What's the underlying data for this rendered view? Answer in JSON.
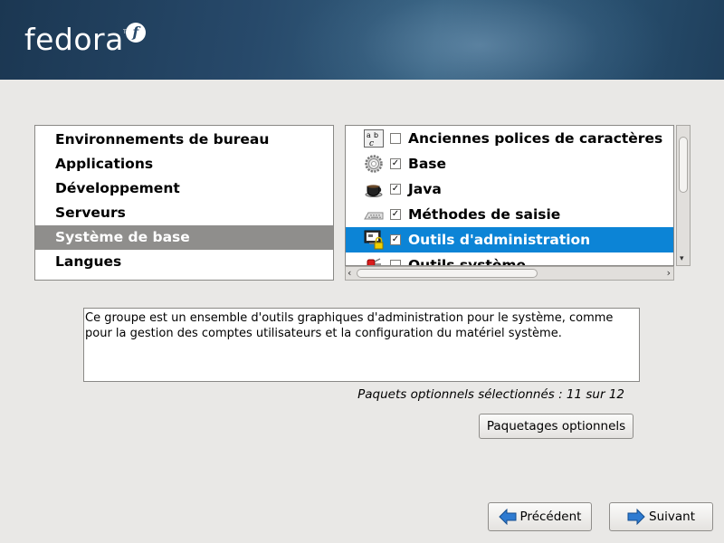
{
  "header": {
    "logo_text": "fedora",
    "logo_mark": "f",
    "logo_tm": "TM"
  },
  "groups": {
    "items": [
      {
        "label": "Environnements de bureau"
      },
      {
        "label": "Applications"
      },
      {
        "label": "Développement"
      },
      {
        "label": "Serveurs"
      },
      {
        "label": "Système de base",
        "selected": true
      },
      {
        "label": "Langues"
      }
    ]
  },
  "packages": {
    "items": [
      {
        "label": "Anciennes polices de caractères",
        "icon": "fonts-icon",
        "checked": false
      },
      {
        "label": "Base",
        "icon": "gear-icon",
        "checked": true
      },
      {
        "label": "Java",
        "icon": "coffee-cup-icon",
        "checked": true
      },
      {
        "label": "Méthodes de saisie",
        "icon": "keyboard-icon",
        "checked": true
      },
      {
        "label": "Outils d'administration",
        "icon": "admin-monitor-lock-icon",
        "checked": true,
        "selected": true
      },
      {
        "label": "Outils système",
        "icon": "system-tools-icon",
        "checked": false
      }
    ]
  },
  "description": {
    "text": "Ce groupe est un ensemble d'outils graphiques d'administration pour le système, comme pour la gestion des comptes utilisateurs et la configuration du matériel système."
  },
  "optional_count": "Paquets optionnels sélectionnés : 11 sur 12",
  "buttons": {
    "optional": "Paquetages optionnels",
    "previous": "Précédent",
    "next": "Suivant"
  },
  "colors": {
    "selection": "#0c84d6",
    "group_selection": "#8f8e8c",
    "arrow": "#1f6fc0"
  }
}
